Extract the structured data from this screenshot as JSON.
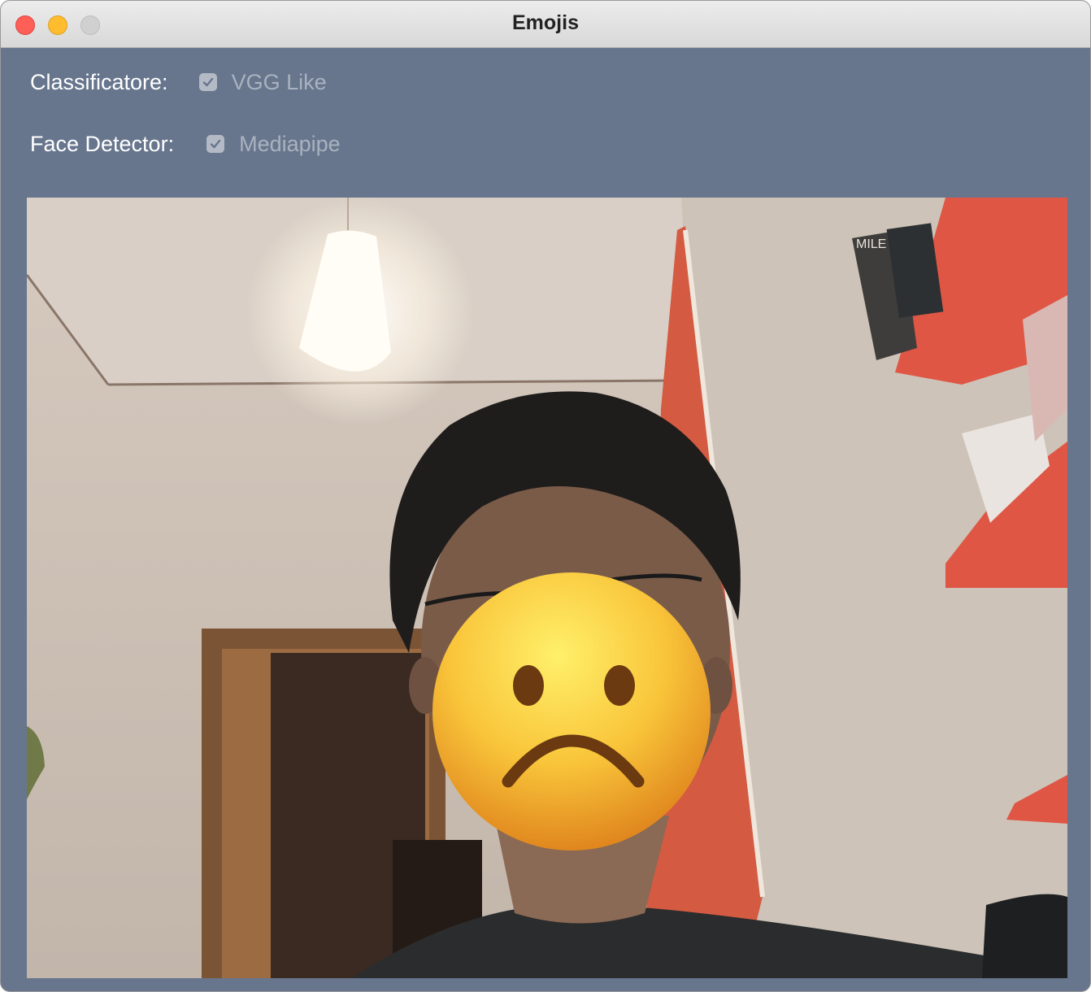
{
  "window": {
    "title": "Emojis"
  },
  "controls": {
    "classifier": {
      "label": "Classificatore:",
      "option": "VGG Like",
      "checked": true
    },
    "face_detector": {
      "label": "Face Detector:",
      "option": "Mediapipe",
      "checked": true
    }
  },
  "video": {
    "emoji": "frowning-face-emoji",
    "book_spine": "MILE"
  },
  "colors": {
    "window_bg": "#67768d",
    "shelves": "#e0574a",
    "emoji_yellow": "#f9c53a"
  }
}
